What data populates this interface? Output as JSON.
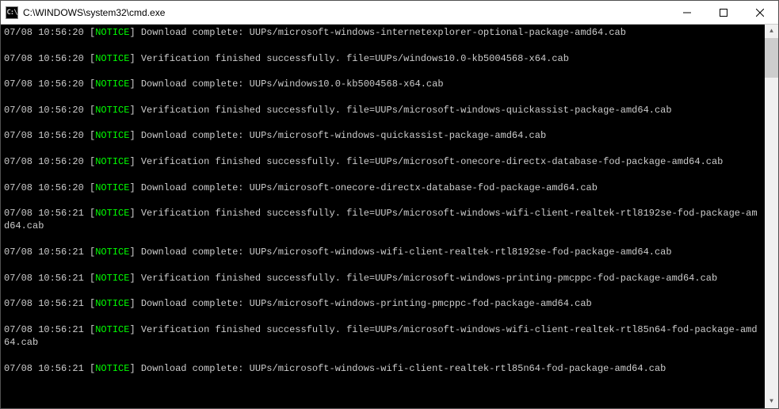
{
  "window": {
    "icon_text": "C:\\",
    "title": "C:\\WINDOWS\\system32\\cmd.exe"
  },
  "logs": [
    {
      "ts": "07/08 10:56:20",
      "level": "NOTICE",
      "msg": "Download complete: UUPs/microsoft-windows-internetexplorer-optional-package-amd64.cab"
    },
    {
      "ts": "07/08 10:56:20",
      "level": "NOTICE",
      "msg": "Verification finished successfully. file=UUPs/windows10.0-kb5004568-x64.cab"
    },
    {
      "ts": "07/08 10:56:20",
      "level": "NOTICE",
      "msg": "Download complete: UUPs/windows10.0-kb5004568-x64.cab"
    },
    {
      "ts": "07/08 10:56:20",
      "level": "NOTICE",
      "msg": "Verification finished successfully. file=UUPs/microsoft-windows-quickassist-package-amd64.cab"
    },
    {
      "ts": "07/08 10:56:20",
      "level": "NOTICE",
      "msg": "Download complete: UUPs/microsoft-windows-quickassist-package-amd64.cab"
    },
    {
      "ts": "07/08 10:56:20",
      "level": "NOTICE",
      "msg": "Verification finished successfully. file=UUPs/microsoft-onecore-directx-database-fod-package-amd64.cab"
    },
    {
      "ts": "07/08 10:56:20",
      "level": "NOTICE",
      "msg": "Download complete: UUPs/microsoft-onecore-directx-database-fod-package-amd64.cab"
    },
    {
      "ts": "07/08 10:56:21",
      "level": "NOTICE",
      "msg": "Verification finished successfully. file=UUPs/microsoft-windows-wifi-client-realtek-rtl8192se-fod-package-amd64.cab"
    },
    {
      "ts": "07/08 10:56:21",
      "level": "NOTICE",
      "msg": "Download complete: UUPs/microsoft-windows-wifi-client-realtek-rtl8192se-fod-package-amd64.cab"
    },
    {
      "ts": "07/08 10:56:21",
      "level": "NOTICE",
      "msg": "Verification finished successfully. file=UUPs/microsoft-windows-printing-pmcppc-fod-package-amd64.cab"
    },
    {
      "ts": "07/08 10:56:21",
      "level": "NOTICE",
      "msg": "Download complete: UUPs/microsoft-windows-printing-pmcppc-fod-package-amd64.cab"
    },
    {
      "ts": "07/08 10:56:21",
      "level": "NOTICE",
      "msg": "Verification finished successfully. file=UUPs/microsoft-windows-wifi-client-realtek-rtl85n64-fod-package-amd64.cab"
    },
    {
      "ts": "07/08 10:56:21",
      "level": "NOTICE",
      "msg": "Download complete: UUPs/microsoft-windows-wifi-client-realtek-rtl85n64-fod-package-amd64.cab"
    }
  ]
}
